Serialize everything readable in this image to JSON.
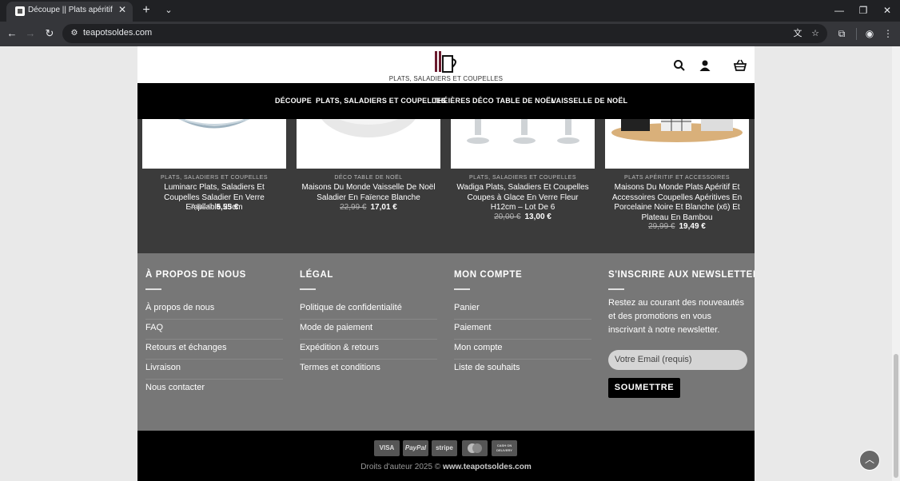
{
  "browser": {
    "tab_title": "Découpe || Plats apéritif et acce",
    "tab_close": "✕",
    "new_tab": "+",
    "tab_search": "⌄",
    "url": "teapotsoldes.com",
    "window_minimize": "—",
    "window_restore": "❐",
    "window_close": "✕"
  },
  "header": {
    "logo_text": "PLATS, SALADIERS ET COUPELLES"
  },
  "nav": {
    "items": [
      "DÉCOUPE",
      "PLATS, SALADIERS ET COUPELLES",
      "THÉIÈRES",
      "DÉCO TABLE DE NOËL",
      "VAISSELLE DE NOËL"
    ]
  },
  "products": [
    {
      "category": "PLATS, SALADIERS ET COUPELLES",
      "title": "Luminarc Plats, Saladiers Et Coupelles Saladier En Verre Empilable 23cm",
      "old_price": "7,50 €",
      "new_price": "5,55 €"
    },
    {
      "category": "DÉCO TABLE DE NOËL",
      "title": "Maisons Du Monde Vaisselle De Noël Saladier En Faïence Blanche",
      "old_price": "22,99 €",
      "new_price": "17,01 €"
    },
    {
      "category": "PLATS, SALADIERS ET COUPELLES",
      "title": "Wadiga Plats, Saladiers Et Coupelles Coupes à Glace En Verre Fleur H12cm – Lot De 6",
      "old_price": "20,00 €",
      "new_price": "13,00 €"
    },
    {
      "category": "PLATS APÉRITIF ET ACCESSOIRES",
      "title": "Maisons Du Monde Plats Apéritif Et Accessoires Coupelles Apéritives En Porcelaine Noire Et Blanche (x6) Et Plateau En Bambou",
      "old_price": "29,99 €",
      "new_price": "19,49 €"
    }
  ],
  "footer": {
    "about": {
      "heading": "À PROPOS DE NOUS",
      "links": [
        "À propos de nous",
        "FAQ",
        "Retours et échanges",
        "Livraison",
        "Nous contacter"
      ]
    },
    "legal": {
      "heading": "LÉGAL",
      "links": [
        "Politique de confidentialité",
        "Mode de paiement",
        "Expédition & retours",
        "Termes et conditions"
      ]
    },
    "account": {
      "heading": "MON COMPTE",
      "links": [
        "Panier",
        "Paiement",
        "Mon compte",
        "Liste de souhaits"
      ]
    },
    "newsletter": {
      "heading": "S'INSCRIRE AUX NEWSLETTERS",
      "text": "Restez au courant des nouveautés et des promotions en vous inscrivant à notre newsletter.",
      "email_placeholder": "Votre Email (requis)",
      "submit_label": "SOUMETTRE"
    }
  },
  "payments": [
    "VISA",
    "PayPal",
    "stripe",
    "mastercard",
    "CASH ON DELIVERY"
  ],
  "copyright": {
    "prefix": "Droits d'auteur 2025 ©",
    "site": "www.teapotsoldes.com"
  },
  "colors": {
    "nav_bg": "#000000",
    "products_bg": "#3b3b3b",
    "footer_bg": "#777777",
    "bottom_bg": "#000000"
  }
}
